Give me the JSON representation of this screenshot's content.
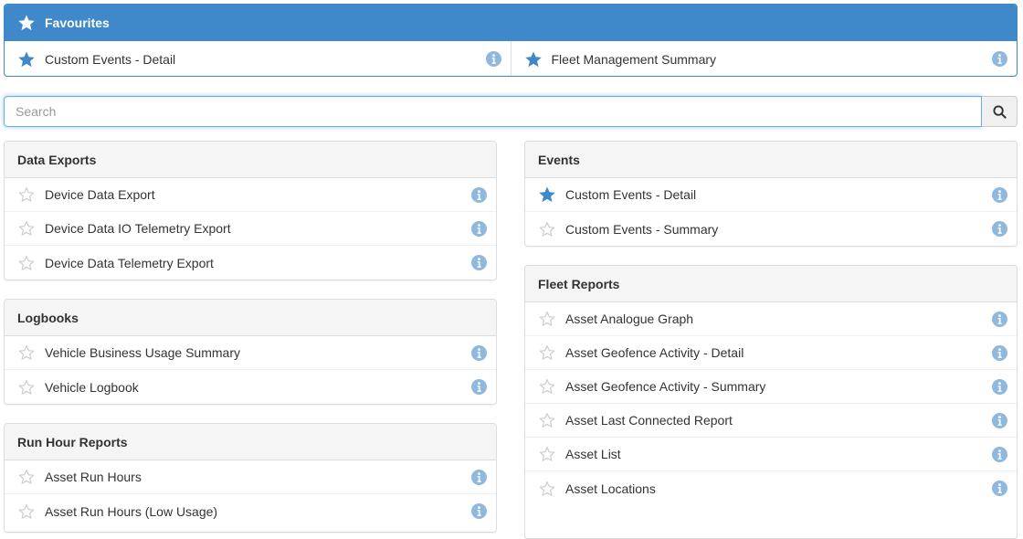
{
  "colors": {
    "accent": "#3f88c9",
    "star_on": "#3f88c9",
    "star_off": "#cccccc",
    "info": "#8fb8de"
  },
  "favourites": {
    "title": "Favourites",
    "items": [
      {
        "label": "Custom Events - Detail"
      },
      {
        "label": "Fleet Management Summary"
      }
    ]
  },
  "search": {
    "placeholder": "Search"
  },
  "groups": [
    {
      "id": "data-exports",
      "title": "Data Exports",
      "items": [
        {
          "label": "Device Data Export",
          "starred": false
        },
        {
          "label": "Device Data IO Telemetry Export",
          "starred": false
        },
        {
          "label": "Device Data Telemetry Export",
          "starred": false
        }
      ]
    },
    {
      "id": "logbooks",
      "title": "Logbooks",
      "items": [
        {
          "label": "Vehicle Business Usage Summary",
          "starred": false
        },
        {
          "label": "Vehicle Logbook",
          "starred": false
        }
      ]
    },
    {
      "id": "run-hour-reports",
      "title": "Run Hour Reports",
      "items": [
        {
          "label": "Asset Run Hours",
          "starred": false
        },
        {
          "label": "Asset Run Hours (Low Usage)",
          "starred": false
        }
      ]
    },
    {
      "id": "events",
      "title": "Events",
      "items": [
        {
          "label": "Custom Events - Detail",
          "starred": true
        },
        {
          "label": "Custom Events - Summary",
          "starred": false
        }
      ]
    },
    {
      "id": "fleet-reports",
      "title": "Fleet Reports",
      "items": [
        {
          "label": "Asset Analogue Graph",
          "starred": false
        },
        {
          "label": "Asset Geofence Activity - Detail",
          "starred": false
        },
        {
          "label": "Asset Geofence Activity - Summary",
          "starred": false
        },
        {
          "label": "Asset Last Connected Report",
          "starred": false
        },
        {
          "label": "Asset List",
          "starred": false
        },
        {
          "label": "Asset Locations",
          "starred": false
        }
      ]
    }
  ]
}
